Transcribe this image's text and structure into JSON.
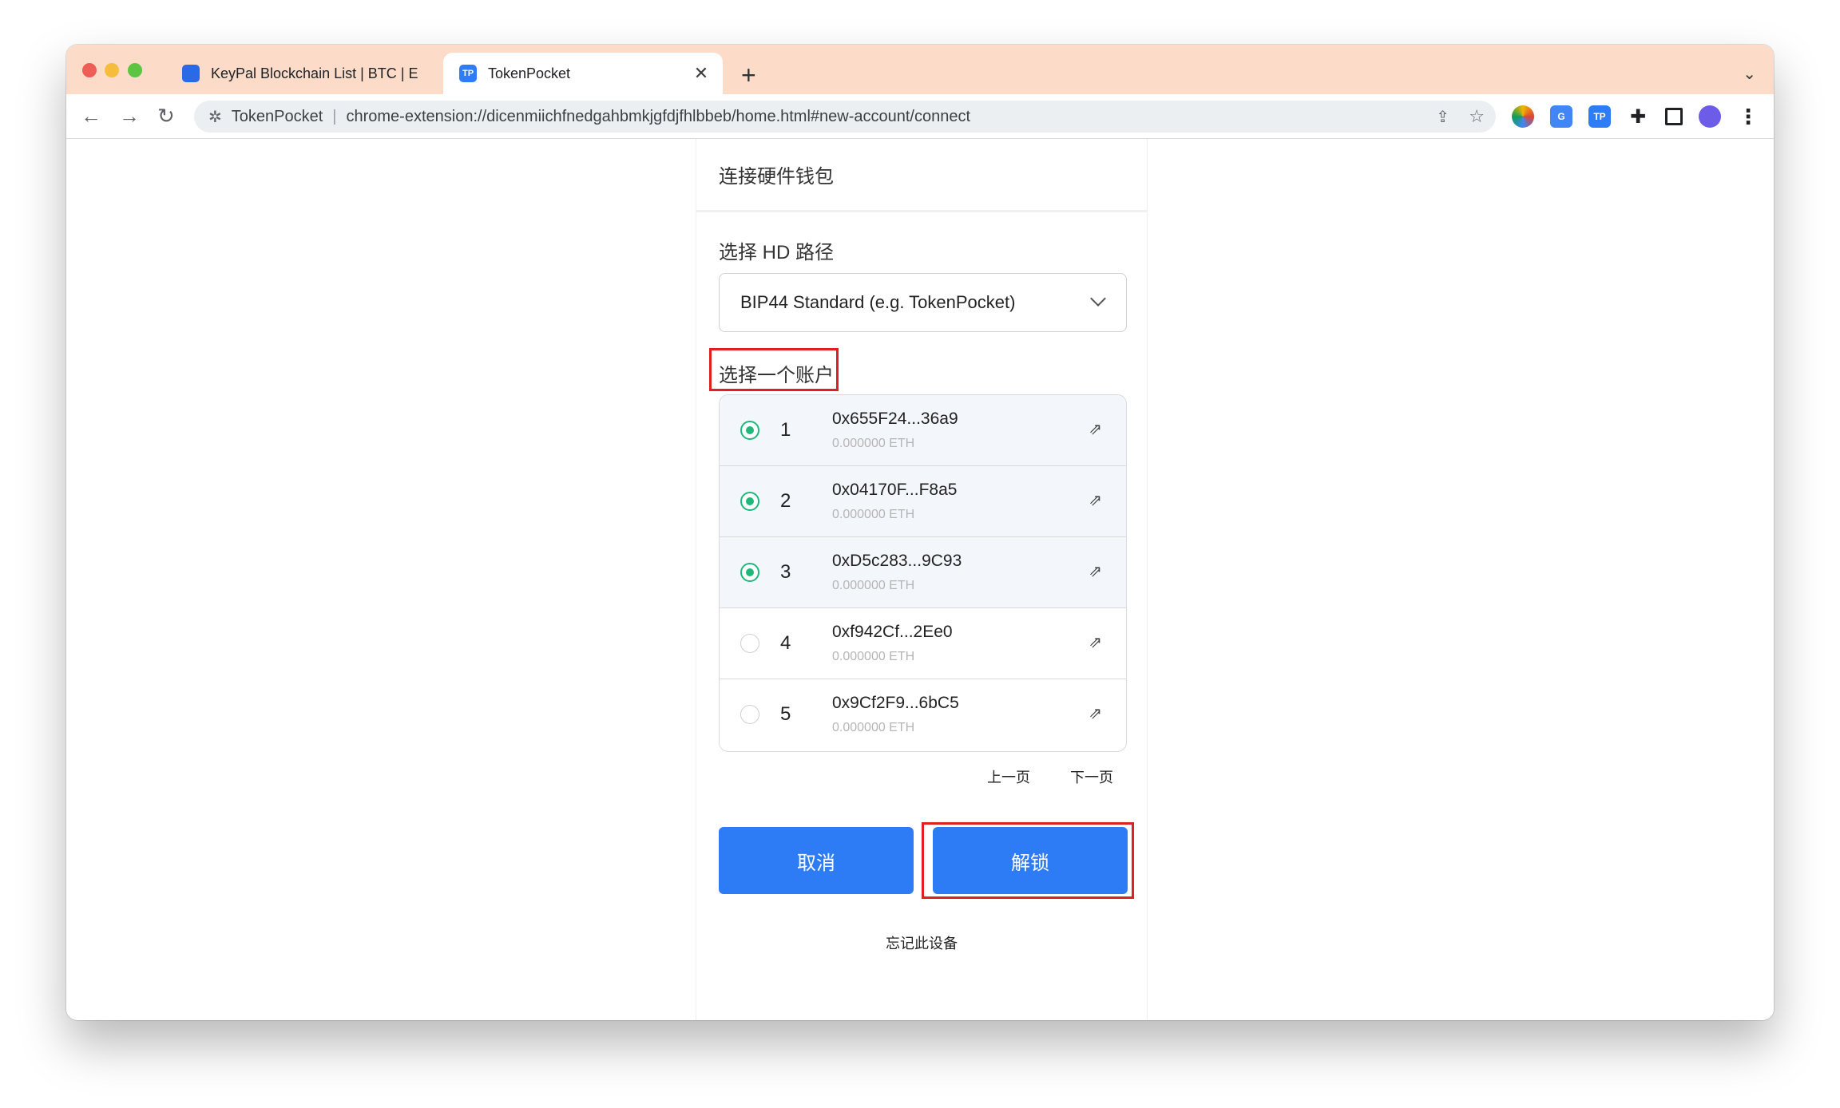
{
  "browser": {
    "tabs": [
      {
        "title": "KeyPal Blockchain List | BTC | E",
        "active": false
      },
      {
        "title": "TokenPocket",
        "active": true
      }
    ],
    "new_tab": "+",
    "omnibox": {
      "site_name": "TokenPocket",
      "url": "chrome-extension://dicenmiichfnedgahbmkjgfdjfhlbbeb/home.html#new-account/connect"
    },
    "extensions": [
      "colorful-extension-icon",
      "google-translate-icon",
      "tokenpocket-icon",
      "puzzle-icon",
      "side-panel-icon",
      "profile-avatar",
      "menu-icon"
    ],
    "tp_icon_text": "TP",
    "translate_icon_text": "G"
  },
  "panel": {
    "header": "连接硬件钱包",
    "hd_label": "选择 HD 路径",
    "hd_path": "BIP44 Standard (e.g. TokenPocket)",
    "account_label": "选择一个账户",
    "accounts": [
      {
        "index": "1",
        "address": "0x655F24...36a9",
        "balance": "0.000000 ETH",
        "selected": true
      },
      {
        "index": "2",
        "address": "0x04170F...F8a5",
        "balance": "0.000000 ETH",
        "selected": true
      },
      {
        "index": "3",
        "address": "0xD5c283...9C93",
        "balance": "0.000000 ETH",
        "selected": true
      },
      {
        "index": "4",
        "address": "0xf942Cf...2Ee0",
        "balance": "0.000000 ETH",
        "selected": false
      },
      {
        "index": "5",
        "address": "0x9Cf2F9...6bC5",
        "balance": "0.000000 ETH",
        "selected": false
      }
    ],
    "prev_page": "上一页",
    "next_page": "下一页",
    "cancel": "取消",
    "unlock": "解锁",
    "forget_device": "忘记此设备"
  },
  "colors": {
    "accent": "#2d7cf6",
    "radio_selected": "#1fb87a",
    "highlight": "#e02020",
    "titlebar": "#fcdcc9"
  }
}
